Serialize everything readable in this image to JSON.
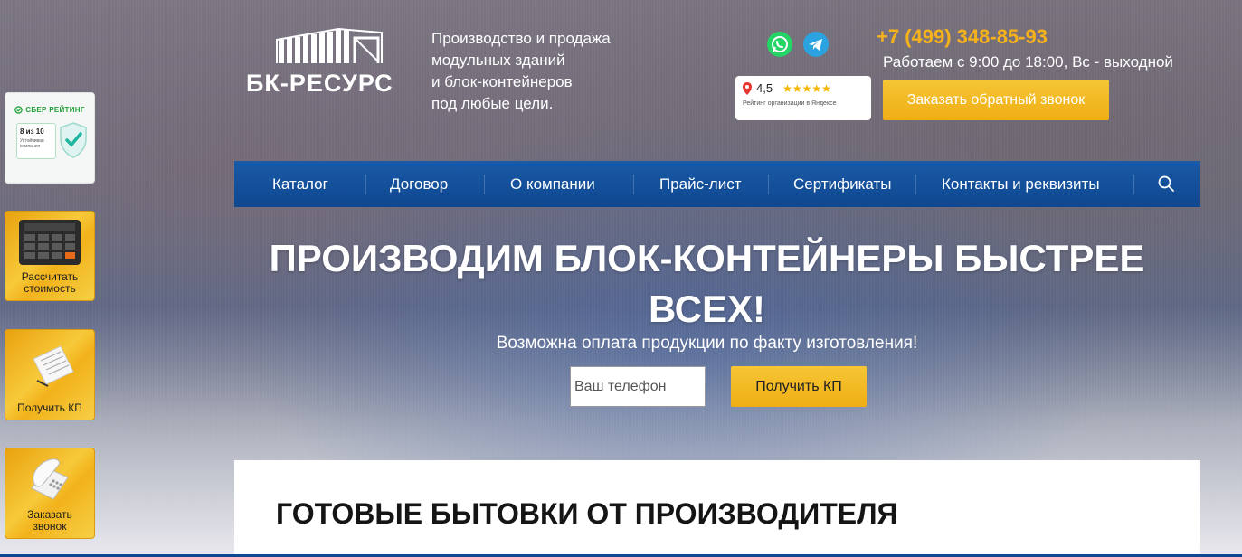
{
  "sidebar": {
    "sber_title": "СБЕР РЕЙТИНГ",
    "sber_score": "8 из 10",
    "sber_sub": "Устойчивая компания",
    "calc_label": "Рассчитать стоимость",
    "kp_label": "Получить КП",
    "call_label": "Заказать звонок"
  },
  "header": {
    "logo_text": "БК-РЕСУРС",
    "tagline": [
      "Производство и продажа",
      "модульных зданий",
      "и блок-контейнеров",
      "под любые цели."
    ],
    "rating_value": "4,5",
    "rating_stars": "★★★★★",
    "rating_caption": "Рейтинг организации в Яндексе",
    "phone": "+7 (499) 348-85-93",
    "hours": "Работаем с 9:00 до 18:00, Вс - выходной",
    "callback_label": "Заказать обратный звонок"
  },
  "nav": {
    "items": [
      "Каталог",
      "Договор",
      "О компании",
      "Прайс-лист",
      "Сертификаты",
      "Контакты и реквизиты"
    ]
  },
  "hero": {
    "title": "ПРОИЗВОДИМ БЛОК-КОНТЕЙНЕРЫ БЫСТРЕЕ ВСЕХ!",
    "subtitle": "Возможна оплата продукции по факту изготовления!",
    "phone_placeholder": "Ваш телефон",
    "submit_label": "Получить КП"
  },
  "section": {
    "title": "ГОТОВЫЕ БЫТОВКИ ОТ ПРОИЗВОДИТЕЛЯ"
  },
  "colors": {
    "accent_gold": "#f6b21b",
    "nav_blue": "#1a5aa6",
    "sber_green": "#21a038"
  },
  "icons": [
    "whatsapp-icon",
    "telegram-icon",
    "map-pin-icon",
    "search-icon",
    "calculator-icon",
    "document-icon",
    "telephone-icon",
    "shield-check-icon",
    "logo-building-icon"
  ]
}
